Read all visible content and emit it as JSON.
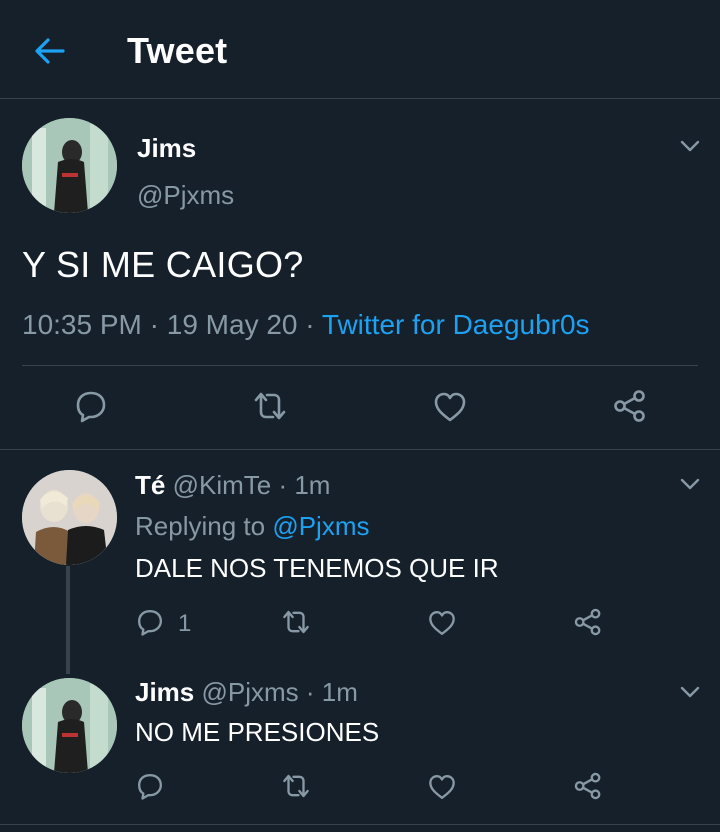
{
  "header": {
    "title": "Tweet"
  },
  "main_tweet": {
    "name": "Jims",
    "handle": "@Pjxms",
    "text": "Y SI ME CAIGO?",
    "time": "10:35 PM",
    "sep1": " · ",
    "date": "19 May 20",
    "sep2": " · ",
    "source": "Twitter for Daegubr0s"
  },
  "replies": [
    {
      "name": "Té",
      "handle": "@KimTe",
      "time_sep": " · ",
      "time": "1m",
      "replying_prefix": "Replying to ",
      "replying_to": "@Pjxms",
      "text": "DALE NOS TENEMOS QUE IR",
      "reply_count": "1"
    },
    {
      "name": "Jims",
      "handle": "@Pjxms",
      "time_sep": " · ",
      "time": "1m",
      "text": "NO ME PRESIONES"
    }
  ],
  "colors": {
    "background": "#15202b",
    "accent": "#1da1f2",
    "secondary_text": "#8899a6",
    "divider": "#38444d"
  },
  "icons": [
    "back-arrow-icon",
    "chevron-down-icon",
    "reply-icon",
    "retweet-icon",
    "like-icon",
    "share-icon"
  ]
}
